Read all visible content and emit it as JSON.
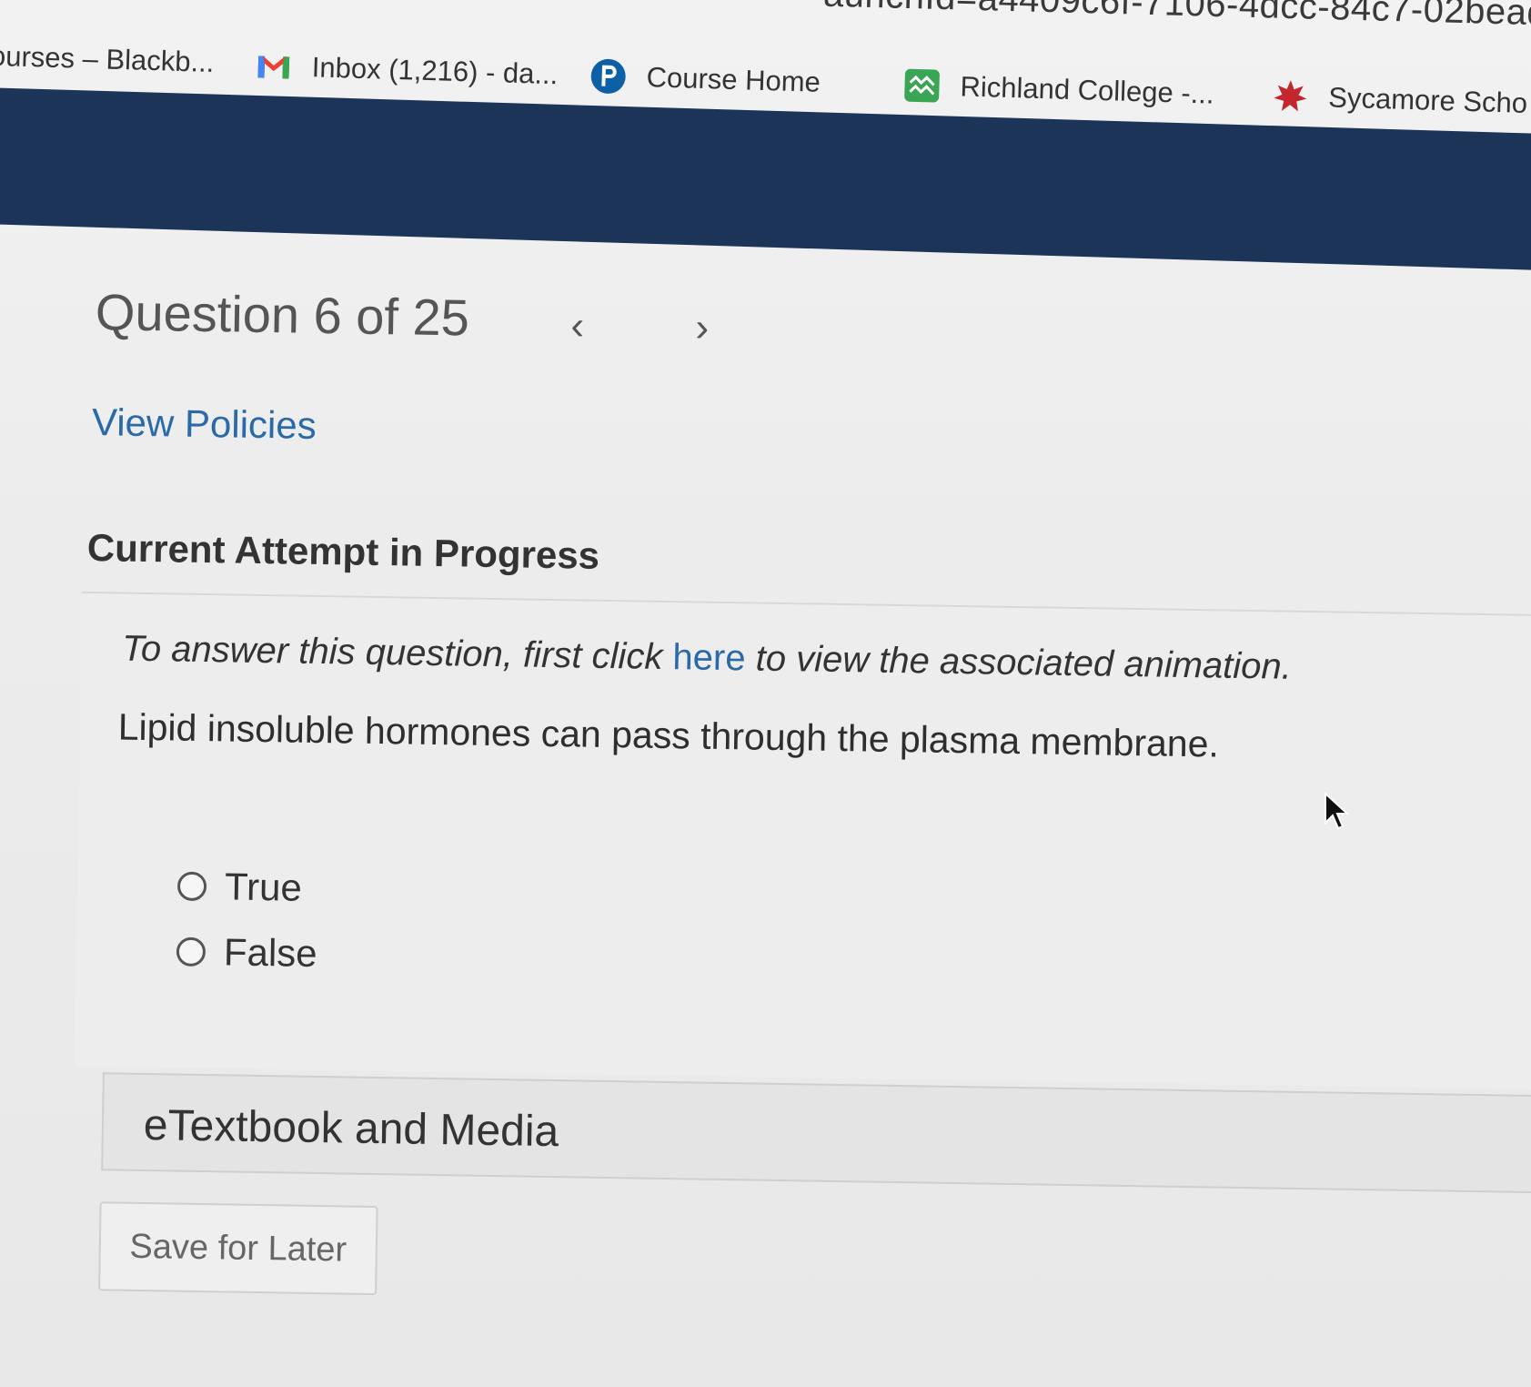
{
  "url_fragment": "aunchId=a4409c6f-7106-4dcc-84c7-02bead",
  "bookmarks": [
    {
      "label": "ourses – Blackb...",
      "icon": "blackboard-icon"
    },
    {
      "label": "Inbox (1,216) - da...",
      "icon": "gmail-icon"
    },
    {
      "label": "Course Home",
      "icon": "pearson-icon"
    },
    {
      "label": "Richland College -...",
      "icon": "richland-icon"
    },
    {
      "label": "Sycamore Scho",
      "icon": "sycamore-icon"
    }
  ],
  "question": {
    "title": "Question 6 of 25",
    "prev_glyph": "‹",
    "next_glyph": "›"
  },
  "view_policies": "View Policies",
  "attempt_heading": "Current Attempt in Progress",
  "instruction": {
    "before": "To answer this question, first click ",
    "link": "here",
    "after": " to view the associated animation."
  },
  "prompt": "Lipid insoluble hormones can pass through the plasma membrane.",
  "options": [
    {
      "label": "True",
      "selected": false
    },
    {
      "label": "False",
      "selected": false
    }
  ],
  "etextbook_label": "eTextbook and Media",
  "save_label": "Save for Later",
  "colors": {
    "header_band": "#1b3458",
    "link": "#2a6aa8",
    "gmail_red": "#d93025",
    "pearson_blue": "#0d5fa6",
    "richland_green": "#3aa655",
    "sycamore_red": "#c4262e"
  }
}
